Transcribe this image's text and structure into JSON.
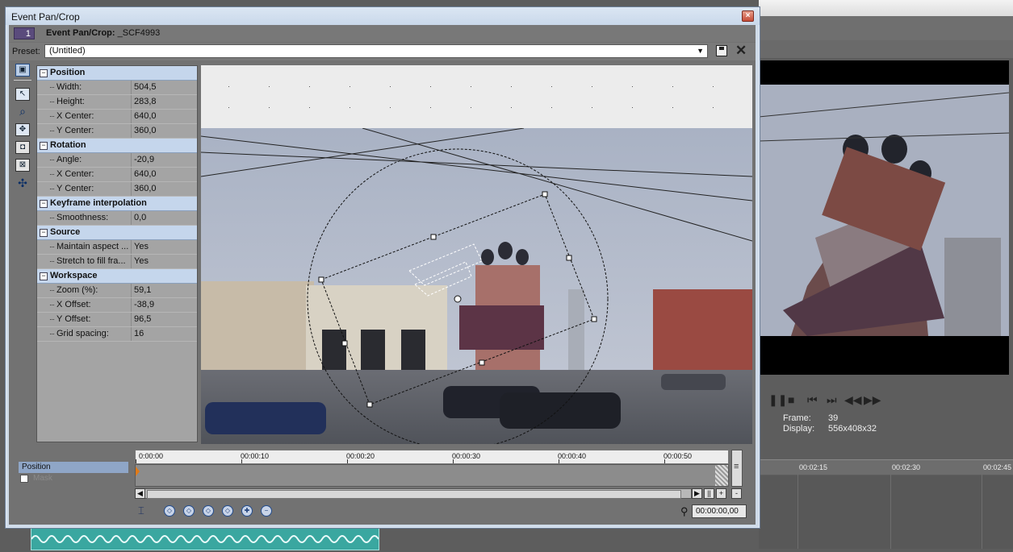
{
  "dialog": {
    "title": "Event Pan/Crop",
    "track_number": "1",
    "header_label": "Event Pan/Crop:",
    "file_name": "_SCF4993",
    "close": "×"
  },
  "preset": {
    "label": "Preset:",
    "value": "(Untitled)"
  },
  "tools": [
    "normal-edit-icon",
    "pointer-icon",
    "zoom-icon",
    "move-icon",
    "fit-icon",
    "frame-icon",
    "pan-icon"
  ],
  "properties": {
    "position": {
      "title": "Position",
      "rows": [
        {
          "name": "Width:",
          "value": "504,5"
        },
        {
          "name": "Height:",
          "value": "283,8"
        },
        {
          "name": "X Center:",
          "value": "640,0"
        },
        {
          "name": "Y Center:",
          "value": "360,0"
        }
      ]
    },
    "rotation": {
      "title": "Rotation",
      "rows": [
        {
          "name": "Angle:",
          "value": "-20,9"
        },
        {
          "name": "X Center:",
          "value": "640,0"
        },
        {
          "name": "Y Center:",
          "value": "360,0"
        }
      ]
    },
    "keyframe": {
      "title": "Keyframe interpolation",
      "rows": [
        {
          "name": "Smoothness:",
          "value": "0,0"
        }
      ]
    },
    "source": {
      "title": "Source",
      "rows": [
        {
          "name": "Maintain aspect ...",
          "value": "Yes"
        },
        {
          "name": "Stretch to fill fra...",
          "value": "Yes"
        }
      ]
    },
    "workspace": {
      "title": "Workspace",
      "rows": [
        {
          "name": "Zoom (%):",
          "value": "59,1"
        },
        {
          "name": "X Offset:",
          "value": "-38,9"
        },
        {
          "name": "Y Offset:",
          "value": "96,5"
        },
        {
          "name": "Grid spacing:",
          "value": "16"
        }
      ]
    }
  },
  "timeline": {
    "tracks": [
      {
        "label": "Position"
      },
      {
        "label": "Mask"
      }
    ],
    "ruler": [
      "0:00:00",
      "00:00:10",
      "00:00:20",
      "00:00:30",
      "00:00:40",
      "00:00:50"
    ],
    "timecode": "00:00:00,00",
    "scroll_btns": [
      "||",
      "+",
      "-"
    ]
  },
  "background_app": {
    "frame_label": "Frame:",
    "frame_value": "39",
    "display_label": "Display:",
    "display_value": "556x408x32",
    "ruler": [
      "00:02:15",
      "00:02:30",
      "00:02:45"
    ]
  }
}
